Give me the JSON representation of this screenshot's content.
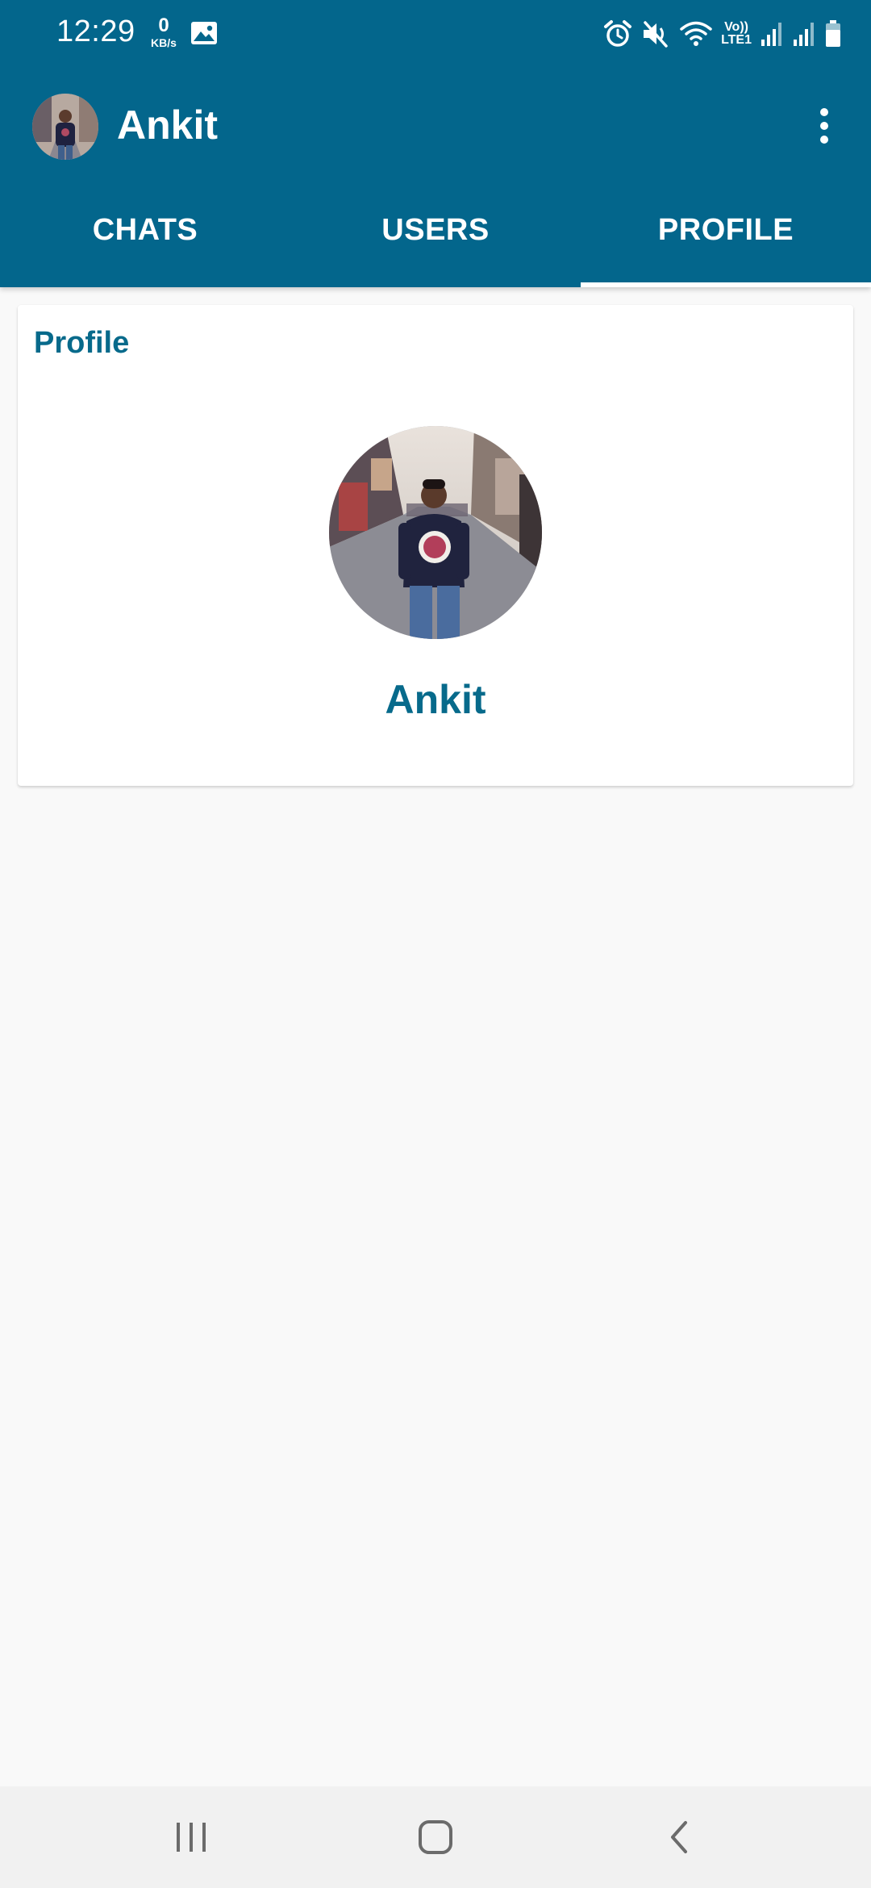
{
  "status_bar": {
    "time": "12:29",
    "net_speed_value": "0",
    "net_speed_unit": "KB/s",
    "network_label_top": "Vo))",
    "network_label_bottom": "LTE1",
    "icons": [
      "gallery-icon",
      "alarm-icon",
      "mute-icon",
      "wifi-icon",
      "signal-icon",
      "signal-icon",
      "battery-icon"
    ]
  },
  "toolbar": {
    "title": "Ankit",
    "menu_icon": "more-vert-icon"
  },
  "tabs": [
    {
      "label": "CHATS",
      "active": false
    },
    {
      "label": "USERS",
      "active": false
    },
    {
      "label": "PROFILE",
      "active": true
    }
  ],
  "profile_card": {
    "heading": "Profile",
    "name": "Ankit"
  },
  "nav_bar": {
    "icons": [
      "recents-icon",
      "home-icon",
      "back-icon"
    ]
  },
  "colors": {
    "primary": "#03668c",
    "accent_text": "#076a8b",
    "background": "#f9f9f9",
    "card": "#ffffff",
    "navbar": "#f1f1f1"
  }
}
